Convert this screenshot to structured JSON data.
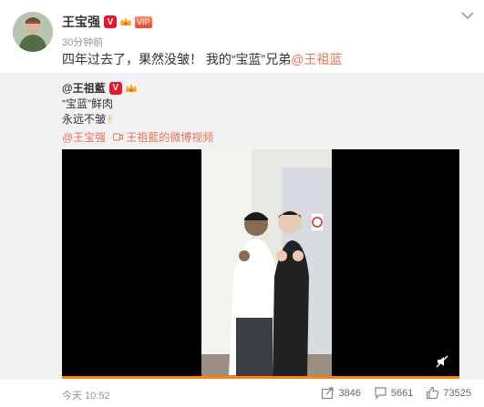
{
  "post": {
    "author": "王宝强",
    "vip_label": "VIP",
    "verified_label": "V",
    "time": "30分钟前",
    "text_prefix": "四年过去了，果然没皱！ 我的“宝蓝”兄弟",
    "text_mention": "@王祖蓝"
  },
  "repost": {
    "author": "@王祖藍",
    "verified_label": "V",
    "line1": "“宝蓝”鲜肉",
    "line2": "永远不皱",
    "line2_emoji": "✌",
    "mention": "@王宝强",
    "video_link_text": "王祖藍的微博视频"
  },
  "video": {
    "progress": 1.0
  },
  "footer": {
    "time": "今天 10:52",
    "repost_count": "3846",
    "comment_count": "5661",
    "like_count": "73525"
  },
  "colors": {
    "accent": "#eb7350",
    "verified": "#e6162d",
    "progress": "#ff8200"
  }
}
